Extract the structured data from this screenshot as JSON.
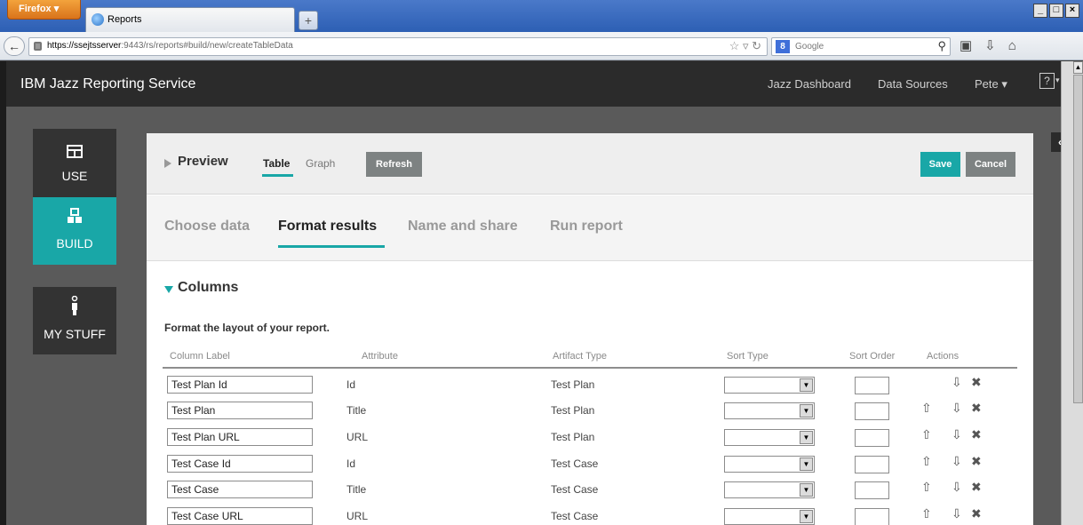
{
  "browser": {
    "menu_label": "Firefox",
    "tab_title": "Reports",
    "new_tab_symbol": "+",
    "url_host": "https://ssejtsserver",
    "url_rest": ":9443/rs/reports#build/new/createTableData",
    "search_engine_label": "8",
    "search_placeholder": "Google",
    "window_buttons": [
      "_",
      "□",
      "×"
    ]
  },
  "app": {
    "title": "IBM Jazz Reporting Service",
    "header_links": [
      "Jazz Dashboard",
      "Data Sources",
      "Pete"
    ],
    "help": "?"
  },
  "sidenav": {
    "items": [
      {
        "label": "USE",
        "icon": "table-icon"
      },
      {
        "label": "BUILD",
        "icon": "blocks-icon",
        "active": true
      },
      {
        "label": "MY STUFF",
        "icon": "person-icon"
      }
    ]
  },
  "preview": {
    "title": "Preview",
    "tabs": [
      "Table",
      "Graph"
    ],
    "refresh_label": "Refresh",
    "save_label": "Save",
    "cancel_label": "Cancel"
  },
  "steps": [
    "Choose data",
    "Format results",
    "Name and share",
    "Run report"
  ],
  "columns": {
    "title": "Columns",
    "subtitle": "Format the layout of your report.",
    "headers": [
      "Column Label",
      "Attribute",
      "Artifact Type",
      "Sort Type",
      "Sort Order",
      "Actions"
    ],
    "rows": [
      {
        "label": "Test Plan Id",
        "attribute": "Id",
        "artifact": "Test Plan"
      },
      {
        "label": "Test Plan",
        "attribute": "Title",
        "artifact": "Test Plan"
      },
      {
        "label": "Test Plan URL",
        "attribute": "URL",
        "artifact": "Test Plan"
      },
      {
        "label": "Test Case Id",
        "attribute": "Id",
        "artifact": "Test Case"
      },
      {
        "label": "Test Case",
        "attribute": "Title",
        "artifact": "Test Case"
      },
      {
        "label": "Test Case URL",
        "attribute": "URL",
        "artifact": "Test Case"
      }
    ]
  },
  "colors": {
    "accent": "#19a7a7",
    "header_bg": "#2b2b2b"
  }
}
